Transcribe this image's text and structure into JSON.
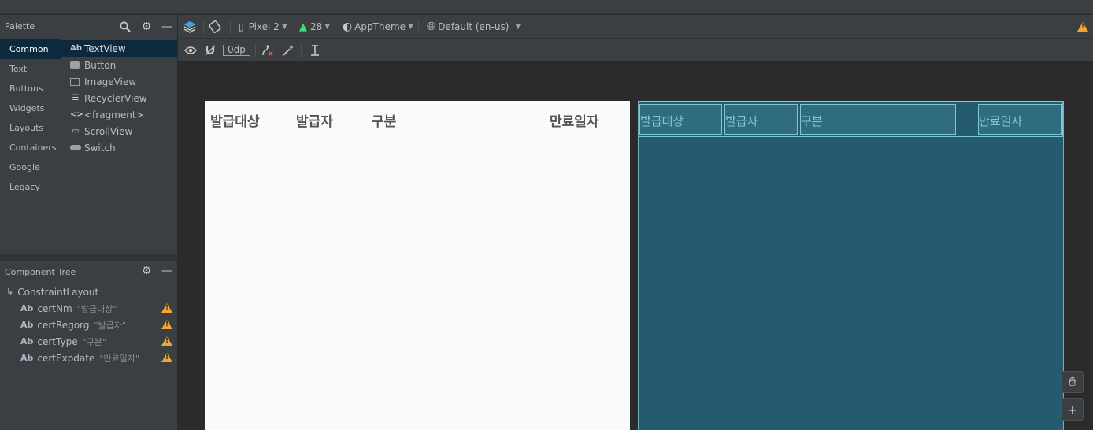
{
  "palette": {
    "title": "Palette",
    "categories": [
      "Common",
      "Text",
      "Buttons",
      "Widgets",
      "Layouts",
      "Containers",
      "Google",
      "Legacy"
    ],
    "widgets": [
      {
        "label": "TextView",
        "icon": "Ab"
      },
      {
        "label": "Button",
        "icon": ""
      },
      {
        "label": "ImageView",
        "icon": ""
      },
      {
        "label": "RecyclerView",
        "icon": "☰"
      },
      {
        "label": "<fragment>",
        "icon": "<>"
      },
      {
        "label": "ScrollView",
        "icon": "▭"
      },
      {
        "label": "Switch",
        "icon": ""
      }
    ]
  },
  "tree": {
    "title": "Component Tree",
    "root": "ConstraintLayout",
    "items": [
      {
        "icon": "Ab",
        "id": "certNm",
        "text": "\"발급대상\""
      },
      {
        "icon": "Ab",
        "id": "certRegorg",
        "text": "\"발급자\""
      },
      {
        "icon": "Ab",
        "id": "certType",
        "text": "\"구분\""
      },
      {
        "icon": "Ab",
        "id": "certExpdate",
        "text": "\"만료일자\""
      }
    ]
  },
  "toolbar": {
    "device": "Pixel 2",
    "api": "28",
    "theme": "AppTheme",
    "locale": "Default (en-us)",
    "margin": "0dp"
  },
  "design": {
    "labels": [
      "발급대상",
      "발급자",
      "구분",
      "만료일자"
    ]
  },
  "blueprint": {
    "labels": [
      "발급대상",
      "발급자",
      "구분",
      "만료일자"
    ]
  },
  "colors": {
    "accent": "#0d293e",
    "warning": "#f0a732",
    "blueprint_bg": "#245b70",
    "design_bg": "#fafafa"
  }
}
